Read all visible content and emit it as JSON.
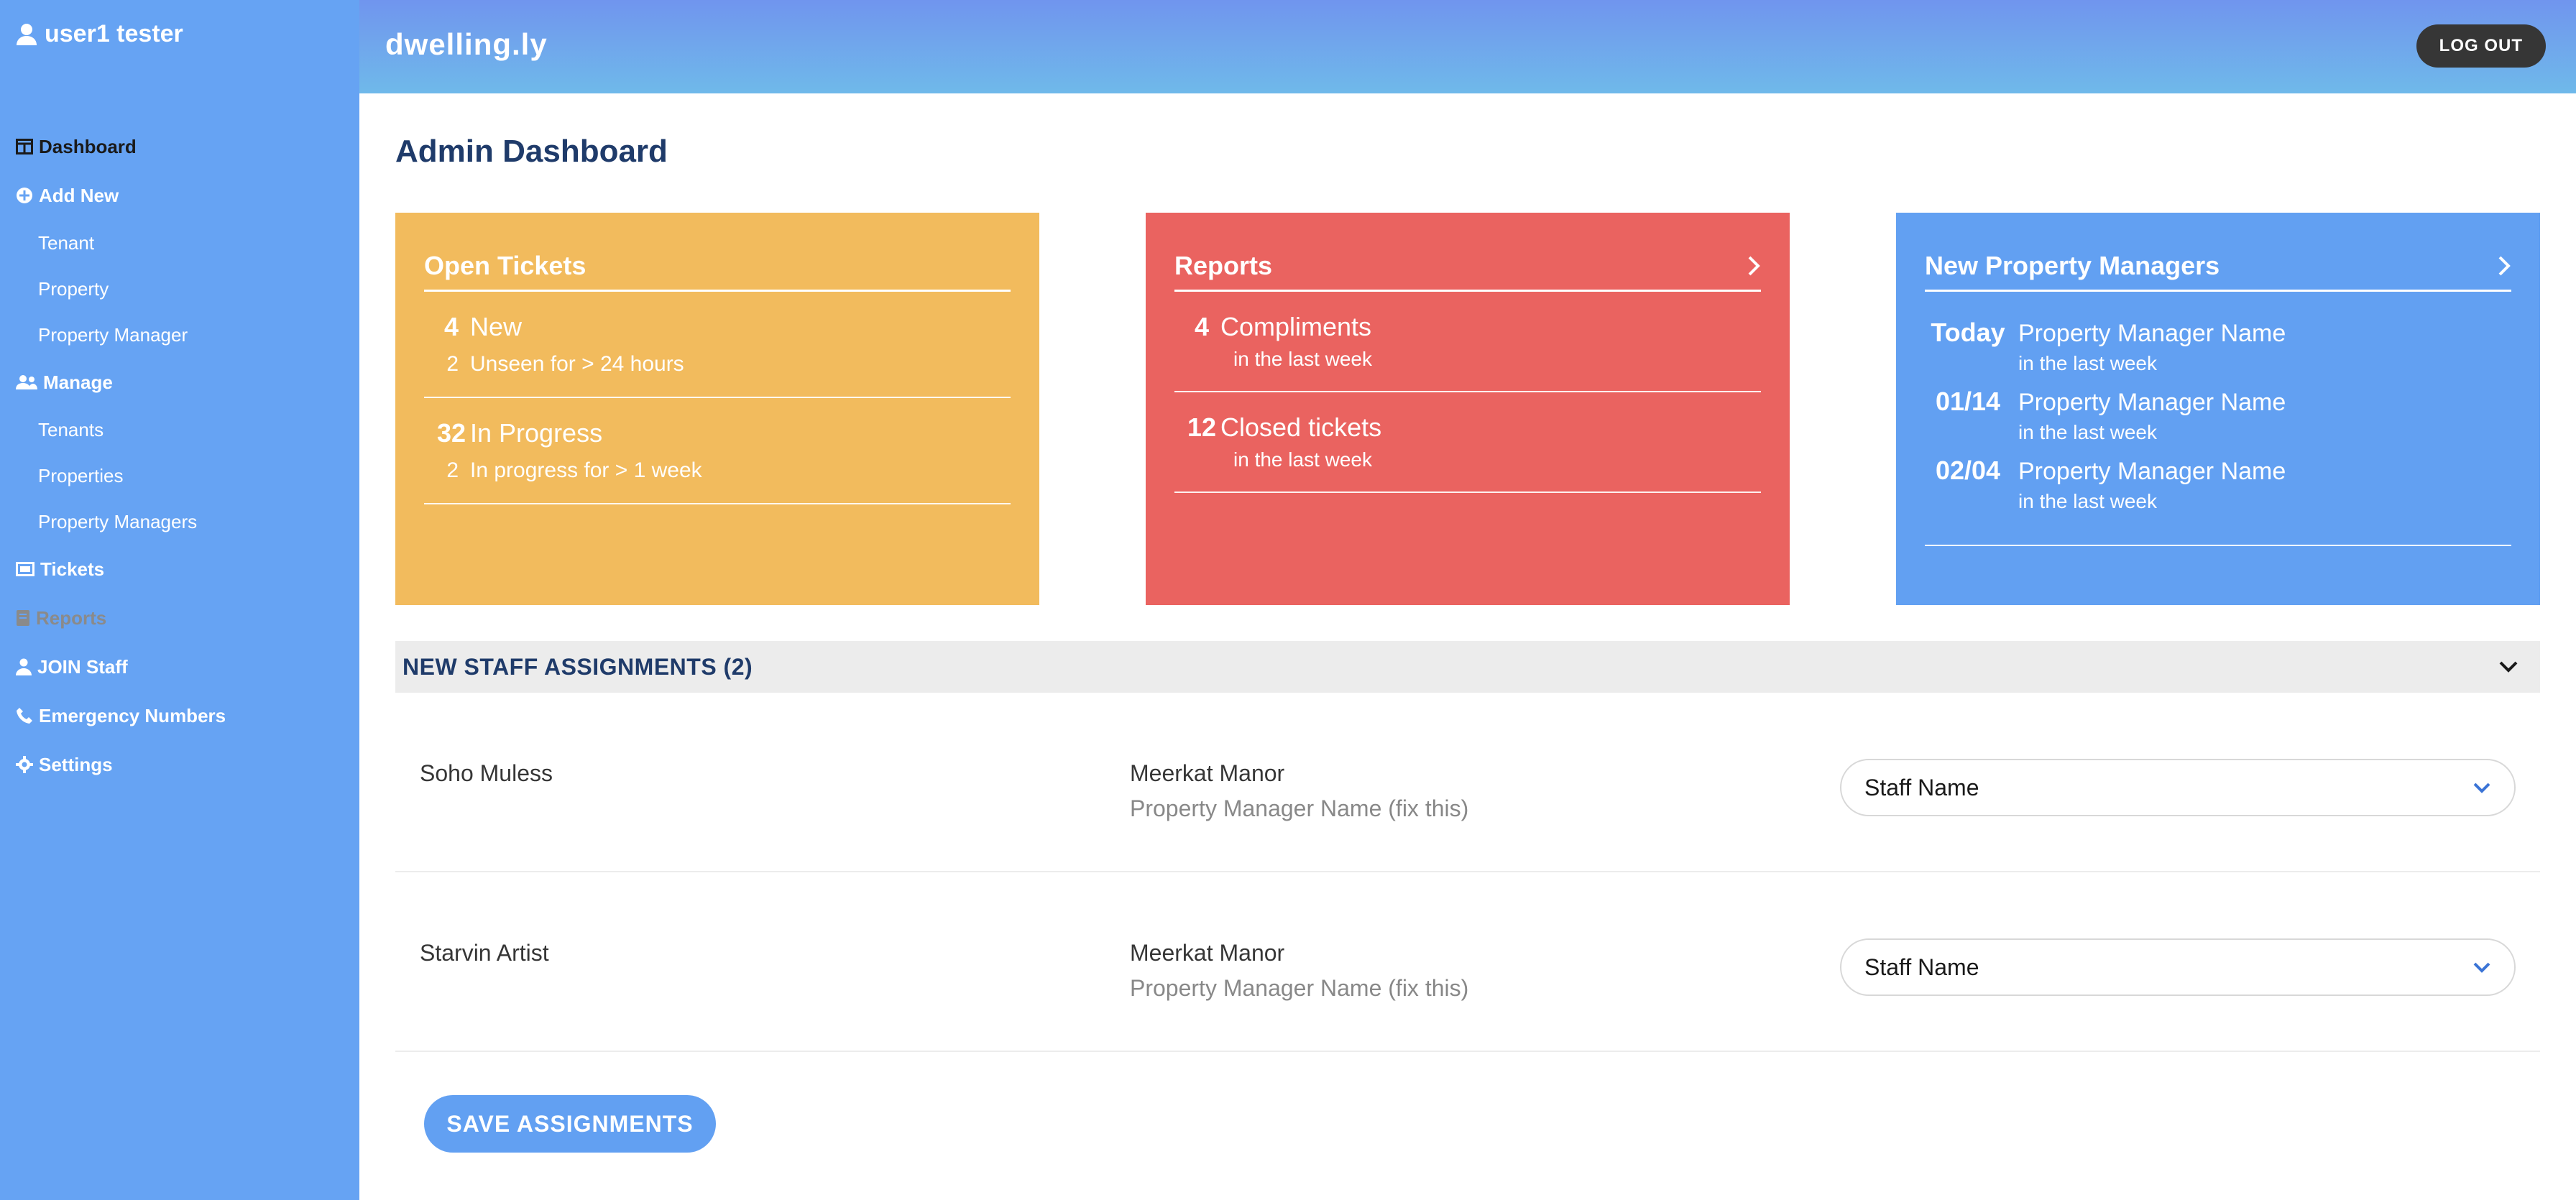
{
  "user": {
    "name": "user1 tester"
  },
  "sidebar": {
    "items": [
      {
        "label": "Dashboard",
        "icon": "dashboard-icon"
      },
      {
        "label": "Add New",
        "icon": "plus-circle-icon",
        "children": [
          "Tenant",
          "Property",
          "Property Manager"
        ]
      },
      {
        "label": "Manage",
        "icon": "users-icon",
        "children": [
          "Tenants",
          "Properties",
          "Property Managers"
        ]
      },
      {
        "label": "Tickets",
        "icon": "ticket-icon"
      },
      {
        "label": "Reports",
        "icon": "book-icon"
      },
      {
        "label": "JOIN Staff",
        "icon": "person-icon"
      },
      {
        "label": "Emergency Numbers",
        "icon": "phone-icon"
      },
      {
        "label": "Settings",
        "icon": "gear-icon"
      }
    ]
  },
  "header": {
    "logo": "dwelling.ly",
    "logout_label": "LOG OUT"
  },
  "main": {
    "title": "Admin Dashboard",
    "cards": {
      "open_tickets": {
        "title": "Open Tickets",
        "sections": [
          {
            "count": "4",
            "label": "New",
            "sub_count": "2",
            "sub_label": "Unseen for > 24 hours"
          },
          {
            "count": "32",
            "label": "In Progress",
            "sub_count": "2",
            "sub_label": "In progress for > 1 week"
          }
        ]
      },
      "reports": {
        "title": "Reports",
        "sections": [
          {
            "count": "4",
            "label": "Compliments",
            "sub": "in the last week"
          },
          {
            "count": "12",
            "label": "Closed tickets",
            "sub": "in the last week"
          }
        ]
      },
      "new_property_managers": {
        "title": "New Property Managers",
        "items": [
          {
            "date": "Today",
            "name": "Property Manager Name",
            "sub": "in the last week"
          },
          {
            "date": "01/14",
            "name": "Property Manager Name",
            "sub": "in the last week"
          },
          {
            "date": "02/04",
            "name": "Property Manager Name",
            "sub": "in the last week"
          }
        ]
      }
    },
    "assignments": {
      "title": "NEW STAFF ASSIGNMENTS (2)",
      "rows": [
        {
          "tenant": "Soho Muless",
          "property": "Meerkat Manor",
          "manager": "Property Manager Name (fix this)",
          "staff": "Staff Name"
        },
        {
          "tenant": "Starvin Artist",
          "property": "Meerkat Manor",
          "manager": "Property Manager Name (fix this)",
          "staff": "Staff Name"
        }
      ],
      "save_label": "SAVE ASSIGNMENTS"
    }
  },
  "colors": {
    "sidebar": "#66a3f3",
    "orange_card": "#f2bb5d",
    "red_card": "#ea6360",
    "blue_card": "#62a0f2",
    "title": "#1f3b6a"
  }
}
